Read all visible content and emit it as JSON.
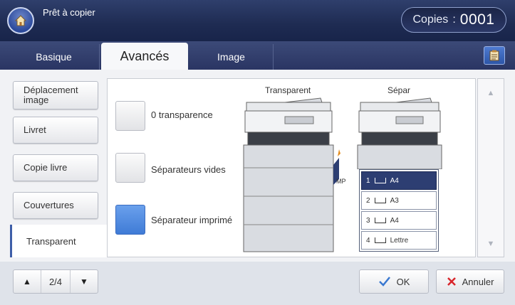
{
  "header": {
    "title": "Prêt à copier",
    "copies_label": "Copies",
    "copies_sep": ":",
    "copies_value": "0001"
  },
  "tabs": [
    {
      "label": "Basique"
    },
    {
      "label": "Avancés",
      "active": true
    },
    {
      "label": "Image"
    }
  ],
  "sidebar": {
    "items": [
      {
        "label": "Déplacement image"
      },
      {
        "label": "Livret"
      },
      {
        "label": "Copie livre"
      },
      {
        "label": "Couvertures"
      },
      {
        "label": "Transparent",
        "active": true
      }
    ]
  },
  "options": [
    {
      "label": "0 transparence",
      "selected": false
    },
    {
      "label": "Séparateurs vides",
      "selected": false
    },
    {
      "label": "Séparateur imprimé",
      "selected": true
    }
  ],
  "illustration": {
    "col1_title": "Transparent",
    "col2_title": "Sépar",
    "mp_label": "MP",
    "trays": [
      {
        "num": "1",
        "size": "A4",
        "selected": true
      },
      {
        "num": "2",
        "size": "A3",
        "selected": false
      },
      {
        "num": "3",
        "size": "A4",
        "selected": false
      },
      {
        "num": "4",
        "size": "Lettre",
        "selected": false
      }
    ]
  },
  "footer": {
    "page_indicator": "2/4",
    "ok_label": "OK",
    "cancel_label": "Annuler"
  },
  "colors": {
    "header": "#1e2b52",
    "accent": "#3f7bd6",
    "tray_selected": "#2d3e72",
    "cancel_icon": "#d8262b",
    "ok_icon": "#3a78d0"
  }
}
